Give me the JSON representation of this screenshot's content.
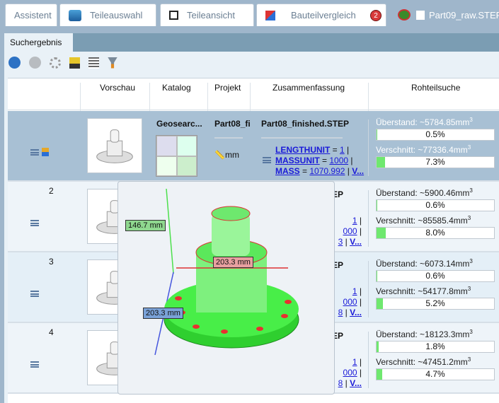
{
  "tabs": [
    {
      "label": "Assistent",
      "icon": "none"
    },
    {
      "label": "Teileauswahl",
      "icon": "books-icon"
    },
    {
      "label": "Teileansicht",
      "icon": "cubes-icon"
    },
    {
      "label": "Bauteilvergleich",
      "icon": "compare-icon",
      "badge": "2"
    },
    {
      "label": "Part09_raw.STEP",
      "icon": "search-part-icon",
      "active": true
    }
  ],
  "subtab": "Suchergebnis",
  "toolbar": [
    "back-icon",
    "forward-icon",
    "settings-icon",
    "favorite-save-icon",
    "table-save-icon",
    "filter-save-icon"
  ],
  "columns": [
    "Vorschau",
    "Katalog",
    "Projekt",
    "Zusammenfassung",
    "Rohteilsuche"
  ],
  "rows": [
    {
      "num": "",
      "catalog": "Geosearc...",
      "project": "Part08_fi",
      "unit": "mm",
      "summary": "Part08_finished.STEP",
      "props": {
        "k1": "LENGTHUNIT",
        "v1": "1",
        "k2": "MASSUNIT",
        "v2": "1000",
        "k3": "MASS",
        "v3": "1070.992",
        "more": "V..."
      },
      "ueber": "Überstand: ~5784.85mm",
      "ueber_pct": "0.5%",
      "ueber_val": 0.5,
      "versch": "Verschnitt: ~77336.4mm",
      "versch_pct": "7.3%",
      "versch_val": 7.3
    },
    {
      "num": "2",
      "summary_tail": "EP",
      "props": {
        "v1": "1",
        "v2": "000",
        "v3": "3",
        "more": "V..."
      },
      "ueber": "Überstand: ~5900.46mm",
      "ueber_pct": "0.6%",
      "ueber_val": 0.6,
      "versch": "Verschnitt: ~85585.4mm",
      "versch_pct": "8.0%",
      "versch_val": 8.0
    },
    {
      "num": "3",
      "summary_tail": "EP",
      "props": {
        "v1": "1",
        "v2": "000",
        "v3": "8",
        "more": "V..."
      },
      "ueber": "Überstand: ~6073.14mm",
      "ueber_pct": "0.6%",
      "ueber_val": 0.6,
      "versch": "Verschnitt: ~54177.8mm",
      "versch_pct": "5.2%",
      "versch_val": 5.2
    },
    {
      "num": "4",
      "summary_tail": "EP",
      "props": {
        "v1": "1",
        "v2": "000",
        "v3": "8",
        "more": "V..."
      },
      "ueber": "Überstand: ~18123.3mm",
      "ueber_pct": "1.8%",
      "ueber_val": 1.8,
      "versch": "Verschnitt: ~47451.2mm",
      "versch_pct": "4.7%",
      "versch_val": 4.7
    }
  ],
  "preview": {
    "dim_height": "146.7 mm",
    "dim_diameter": "203.3 mm",
    "dim_depth": "203.3 mm"
  }
}
